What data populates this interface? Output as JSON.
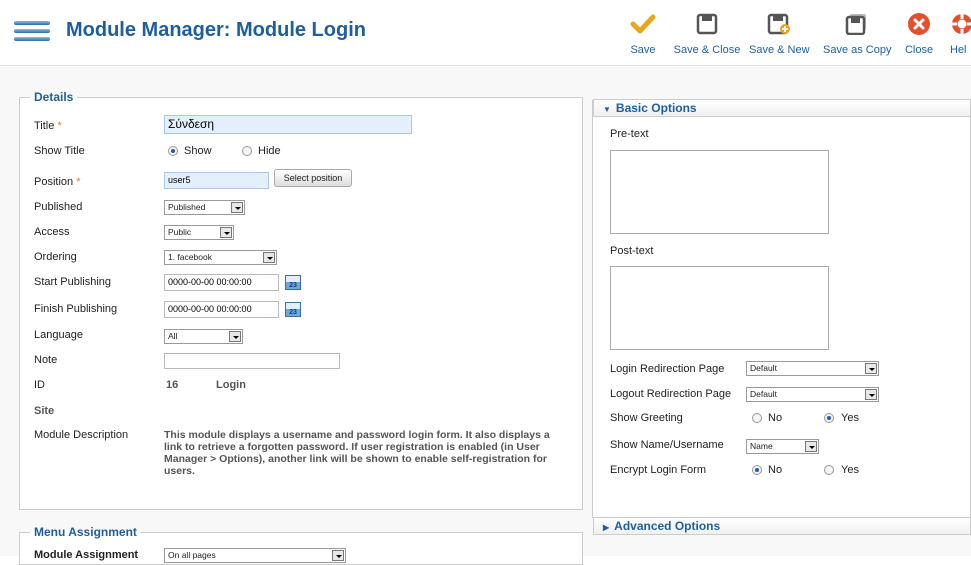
{
  "header": {
    "title": "Module Manager: Module Login",
    "menu_icon": "hamburger-menu-icon"
  },
  "toolbar": {
    "save": "Save",
    "save_close": "Save & Close",
    "save_new": "Save & New",
    "save_copy": "Save as Copy",
    "close": "Close",
    "help": "Hel",
    "accent_color": "#1e5e9e",
    "save_check_color": "#e8a520",
    "close_color": "#e2502e"
  },
  "details": {
    "legend": "Details",
    "title_label": "Title",
    "title_value": "Σύνδεση",
    "required_mark": "*",
    "show_title_label": "Show Title",
    "show_label": "Show",
    "hide_label": "Hide",
    "position_label": "Position",
    "position_value": "user5",
    "select_position": "Select position",
    "published_label": "Published",
    "published_value": "Published",
    "access_label": "Access",
    "access_value": "Public",
    "ordering_label": "Ordering",
    "ordering_value": "1. facebook",
    "start_label": "Start Publishing",
    "start_value": "0000-00-00 00:00:00",
    "finish_label": "Finish Publishing",
    "finish_value": "0000-00-00 00:00:00",
    "calendar_text": "23",
    "language_label": "Language",
    "language_value": "All",
    "note_label": "Note",
    "note_value": "",
    "id_label": "ID",
    "id_value": "16",
    "id_name": "Login",
    "site_label": "Site",
    "module_desc_label": "Module Description",
    "module_desc": "This module displays a username and password login form. It also displays a link to retrieve a forgotten password. If user registration is enabled (in User Manager > Options), another link will be shown to enable self-registration for users."
  },
  "menu_assignment": {
    "legend": "Menu Assignment",
    "label": "Module Assignment",
    "value": "On all pages"
  },
  "basic": {
    "header": "Basic Options",
    "pretext_label": "Pre-text",
    "posttext_label": "Post-text",
    "login_redirect_label": "Login Redirection Page",
    "login_redirect_value": "Default",
    "logout_redirect_label": "Logout Redirection Page",
    "logout_redirect_value": "Default",
    "greeting_label": "Show Greeting",
    "no_label": "No",
    "yes_label": "Yes",
    "name_label": "Show Name/Username",
    "name_value": "Name",
    "encrypt_label": "Encrypt Login Form"
  },
  "advanced": {
    "header": "Advanced Options"
  }
}
